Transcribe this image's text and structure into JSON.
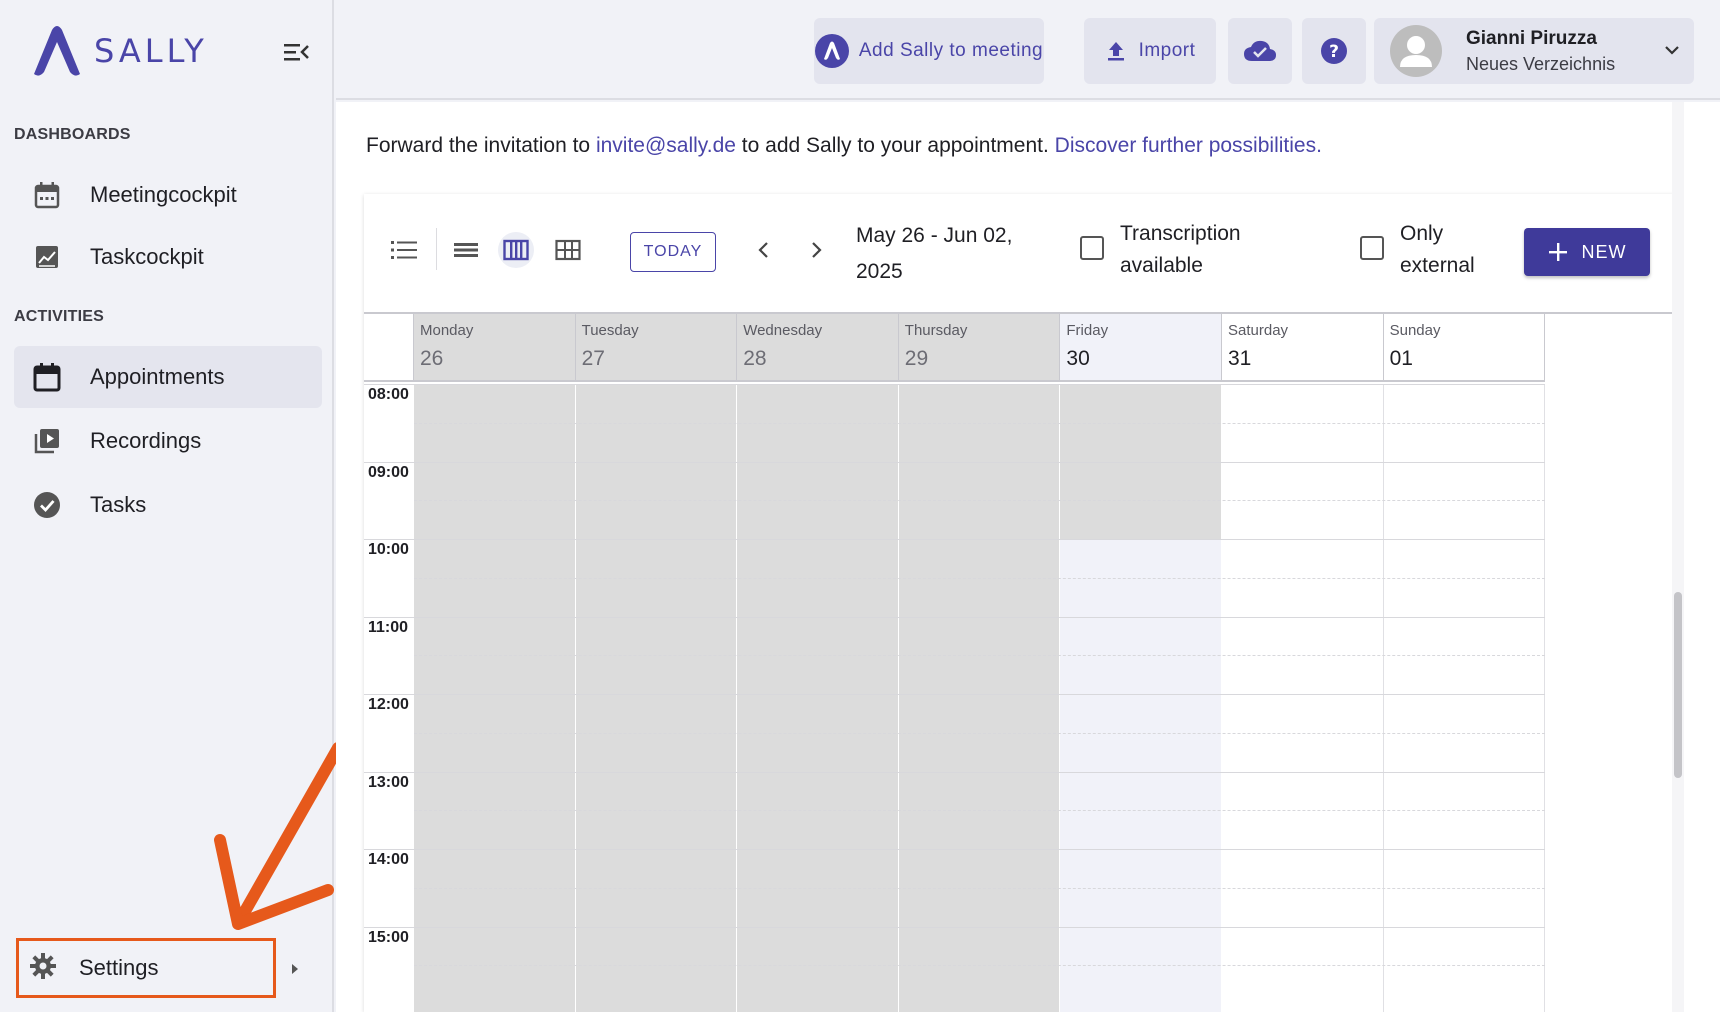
{
  "app": {
    "logo_text": "SALLY",
    "brand_color": "#4a45a8"
  },
  "sidebar": {
    "sections": [
      {
        "label": "DASHBOARDS"
      },
      {
        "label": "ACTIVITIES"
      }
    ],
    "items": [
      {
        "label": "Meetingcockpit",
        "icon": "calendar-dots-icon"
      },
      {
        "label": "Taskcockpit",
        "icon": "chart-icon"
      },
      {
        "label": "Appointments",
        "icon": "calendar-icon",
        "active": true
      },
      {
        "label": "Recordings",
        "icon": "video-library-icon"
      },
      {
        "label": "Tasks",
        "icon": "check-circle-icon"
      }
    ],
    "settings_label": "Settings"
  },
  "topbar": {
    "add_sally_label": "Add Sally to meeting",
    "import_label": "Import",
    "user_name": "Gianni Piruzza",
    "user_sub": "Neues Verzeichnis"
  },
  "content": {
    "forward_prefix": "Forward the invitation to ",
    "forward_email": "invite@sally.de",
    "forward_middle": " to add Sally to your appointment. ",
    "forward_link": "Discover further possibilities."
  },
  "calendar": {
    "today_label": "TODAY",
    "date_range_line1": "May 26 - Jun 02,",
    "date_range_line2": "2025",
    "filter_transcription_line1": "Transcription",
    "filter_transcription_line2": "available",
    "filter_external_line1": "Only",
    "filter_external_line2": "external",
    "new_label": "NEW",
    "days": [
      {
        "name": "Monday",
        "num": "26",
        "state": "past"
      },
      {
        "name": "Tuesday",
        "num": "27",
        "state": "past"
      },
      {
        "name": "Wednesday",
        "num": "28",
        "state": "past"
      },
      {
        "name": "Thursday",
        "num": "29",
        "state": "past"
      },
      {
        "name": "Friday",
        "num": "30",
        "state": "today"
      },
      {
        "name": "Saturday",
        "num": "31",
        "state": "future"
      },
      {
        "name": "Sunday",
        "num": "01",
        "state": "future"
      }
    ],
    "times": [
      "08:00",
      "09:00",
      "10:00",
      "11:00",
      "12:00",
      "13:00",
      "14:00",
      "15:00"
    ]
  },
  "annotation_color": "#e6591b"
}
